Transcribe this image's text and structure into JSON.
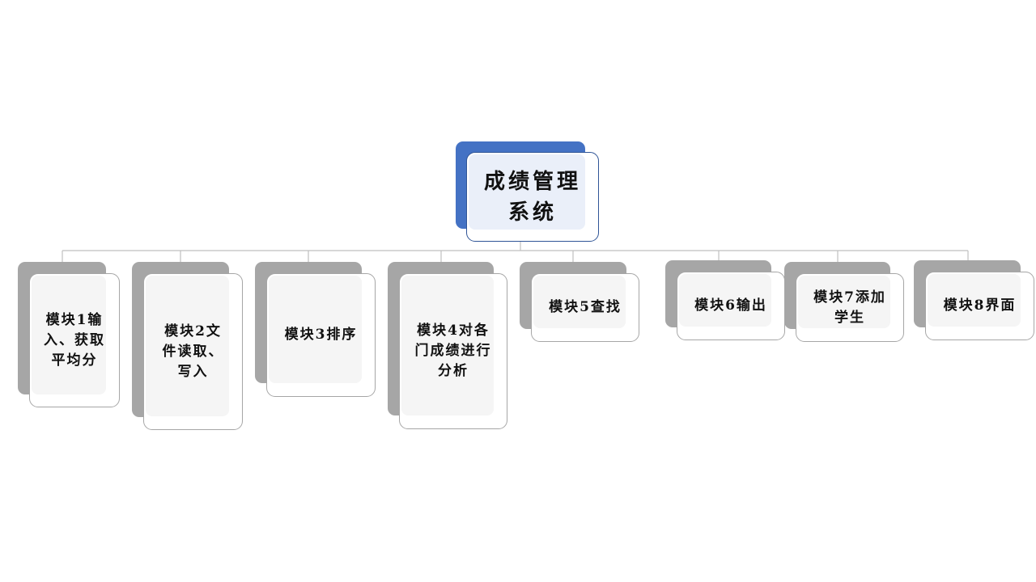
{
  "colors": {
    "root_backplate": "#4472c4",
    "root_card_border": "#2f5496",
    "root_card_fill": "#eaeff9",
    "module_backplate": "#a6a6a6",
    "module_card_fill": "#f5f5f5",
    "connector": "#bfbfbf"
  },
  "root": {
    "label": "成绩管理\n系统"
  },
  "modules": [
    {
      "id": "m1",
      "label": "模块1输\n入、获取\n平均分"
    },
    {
      "id": "m2",
      "label": "模块2文\n件读取、\n写入"
    },
    {
      "id": "m3",
      "label": "模块3排序"
    },
    {
      "id": "m4",
      "label": "模块4对各\n门成绩进行\n分析"
    },
    {
      "id": "m5",
      "label": "模块5查找"
    },
    {
      "id": "m6",
      "label": "模块6输出"
    },
    {
      "id": "m7",
      "label": "模块7添加\n学生"
    },
    {
      "id": "m8",
      "label": "模块8界面"
    }
  ]
}
